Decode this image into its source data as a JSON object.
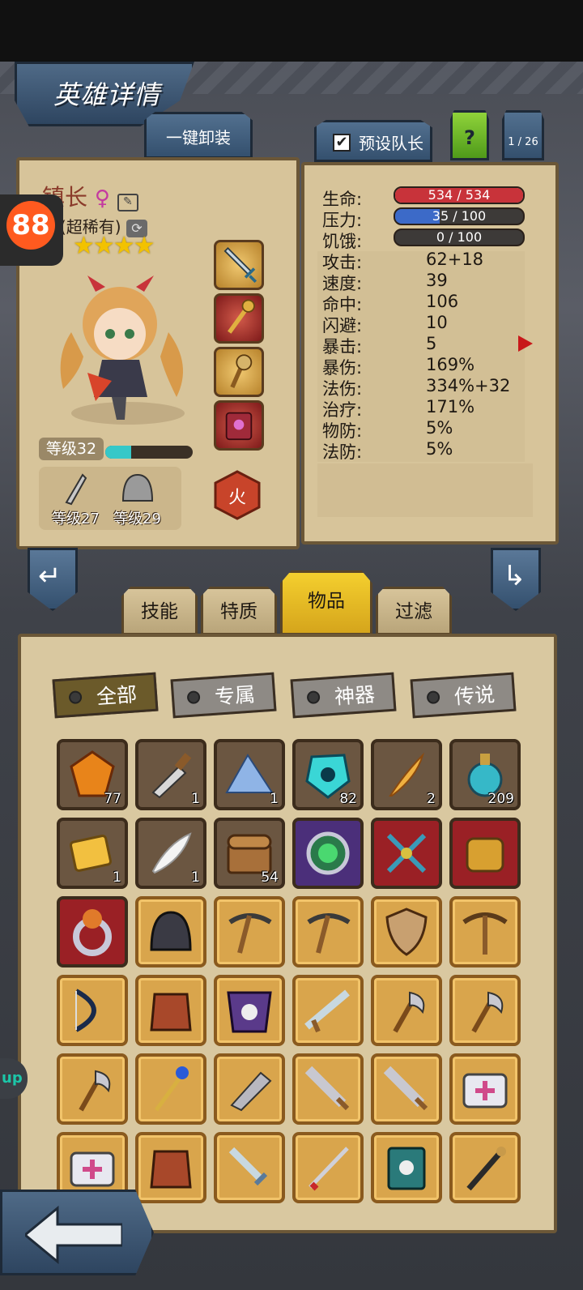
{
  "header": {
    "title": "英雄详情"
  },
  "buttons": {
    "unequip_all": "一键卸装",
    "preset_leader": "预设队长",
    "help": "?",
    "pager": "1 / 26"
  },
  "hero": {
    "name": "镇长",
    "rarity": "(超稀有)",
    "stars": "★★★★",
    "level_label": "等级32",
    "xp_fraction": 0.3,
    "weapon_level": "等级27",
    "armor_level": "等级29",
    "element": "火"
  },
  "stats": {
    "hp_label": "生命:",
    "hp_value": "534 / 534",
    "hp_fraction": 1.0,
    "stress_label": "压力:",
    "stress_value": "35 / 100",
    "stress_fraction": 0.35,
    "hunger_label": "饥饿:",
    "hunger_value": "0 / 100",
    "hunger_fraction": 0,
    "rows": [
      {
        "label": "攻击:",
        "value": "62+18"
      },
      {
        "label": "速度:",
        "value": "39"
      },
      {
        "label": "命中:",
        "value": "106"
      },
      {
        "label": "闪避:",
        "value": "10"
      },
      {
        "label": "暴击:",
        "value": "5"
      },
      {
        "label": "暴伤:",
        "value": "169%"
      },
      {
        "label": "法伤:",
        "value": "334%+32"
      },
      {
        "label": "治疗:",
        "value": "171%"
      },
      {
        "label": "物防:",
        "value": "5%"
      },
      {
        "label": "法防:",
        "value": "5%"
      }
    ]
  },
  "tabs": {
    "skills": "技能",
    "traits": "特质",
    "items": "物品",
    "filter": "过滤"
  },
  "filters": {
    "all": "全部",
    "exclusive": "专属",
    "artifact": "神器",
    "legendary": "传说"
  },
  "inventory": [
    {
      "icon": "gem-icon",
      "count": "77",
      "rarity": "brown"
    },
    {
      "icon": "knife-icon",
      "count": "1",
      "rarity": "brown"
    },
    {
      "icon": "crystal-pile-icon",
      "count": "1",
      "rarity": "brown"
    },
    {
      "icon": "rune-stone-icon",
      "count": "82",
      "rarity": "brown"
    },
    {
      "icon": "feather-quill-icon",
      "count": "2",
      "rarity": "brown"
    },
    {
      "icon": "potion-icon",
      "count": "209",
      "rarity": "brown"
    },
    {
      "icon": "ticket-icon",
      "count": "1",
      "rarity": "brown"
    },
    {
      "icon": "feather-icon",
      "count": "1",
      "rarity": "brown"
    },
    {
      "icon": "chest-icon",
      "count": "54",
      "rarity": "brown"
    },
    {
      "icon": "green-orb-icon",
      "count": "",
      "rarity": "purple"
    },
    {
      "icon": "cross-staff-icon",
      "count": "",
      "rarity": "red"
    },
    {
      "icon": "gauntlet-icon",
      "count": "",
      "rarity": "red"
    },
    {
      "icon": "ring-icon",
      "count": "",
      "rarity": "red"
    },
    {
      "icon": "helmet-icon",
      "count": "",
      "rarity": "gold"
    },
    {
      "icon": "pickaxe-icon",
      "count": "",
      "rarity": "gold"
    },
    {
      "icon": "pickaxe-icon",
      "count": "",
      "rarity": "gold"
    },
    {
      "icon": "shield-icon",
      "count": "",
      "rarity": "gold"
    },
    {
      "icon": "crossbow-icon",
      "count": "",
      "rarity": "gold"
    },
    {
      "icon": "bow-icon",
      "count": "",
      "rarity": "gold"
    },
    {
      "icon": "armor-icon",
      "count": "",
      "rarity": "gold"
    },
    {
      "icon": "skull-cloak-icon",
      "count": "",
      "rarity": "gold"
    },
    {
      "icon": "rifle-icon",
      "count": "",
      "rarity": "gold"
    },
    {
      "icon": "axe-icon",
      "count": "",
      "rarity": "gold"
    },
    {
      "icon": "axe-icon",
      "count": "",
      "rarity": "gold"
    },
    {
      "icon": "axe-icon",
      "count": "",
      "rarity": "gold"
    },
    {
      "icon": "staff-icon",
      "count": "",
      "rarity": "gold"
    },
    {
      "icon": "cleaver-icon",
      "count": "",
      "rarity": "gold"
    },
    {
      "icon": "greatsword-icon",
      "count": "",
      "rarity": "gold"
    },
    {
      "icon": "greatsword-icon",
      "count": "",
      "rarity": "gold"
    },
    {
      "icon": "medkit-icon",
      "count": "",
      "rarity": "gold"
    },
    {
      "icon": "medkit-icon",
      "count": "",
      "rarity": "gold"
    },
    {
      "icon": "armor-icon",
      "count": "",
      "rarity": "gold"
    },
    {
      "icon": "sword-icon",
      "count": "",
      "rarity": "gold"
    },
    {
      "icon": "katana-icon",
      "count": "",
      "rarity": "gold"
    },
    {
      "icon": "spellbook-icon",
      "count": "",
      "rarity": "gold"
    },
    {
      "icon": "rod-icon",
      "count": "",
      "rarity": "gold"
    }
  ],
  "side_tag": "up",
  "colors": {
    "hp": "#c8333a",
    "stress": "#3c6ac8",
    "hunger": "#3d3a38",
    "accent": "#f4cf2e"
  }
}
